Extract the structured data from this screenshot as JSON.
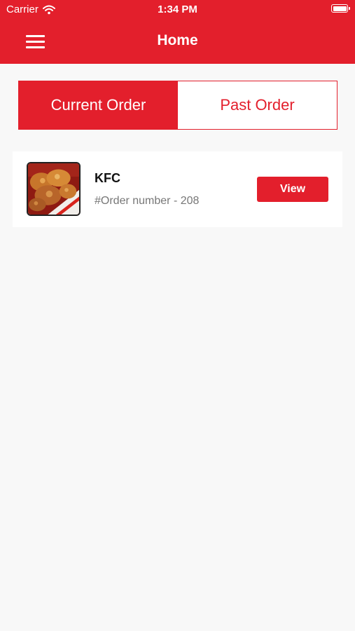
{
  "status_bar": {
    "carrier": "Carrier",
    "time": "1:34 PM"
  },
  "header": {
    "title": "Home"
  },
  "segments": [
    {
      "label": "Current Order",
      "active": true
    },
    {
      "label": "Past Order",
      "active": false
    }
  ],
  "orders": [
    {
      "restaurant": "KFC",
      "order_number": "#Order number - 208",
      "button_label": "View"
    }
  ],
  "colors": {
    "brand_red": "#e31f2c",
    "background": "#f8f8f8",
    "muted_text": "#777777"
  },
  "icons": {
    "menu": "hamburger-menu-icon",
    "wifi": "wifi-icon",
    "battery": "battery-icon"
  }
}
